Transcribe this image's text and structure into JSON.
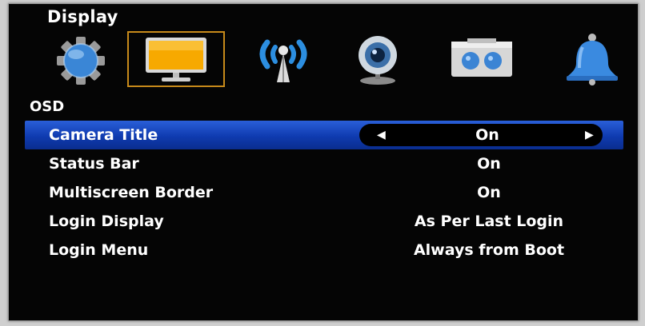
{
  "header": {
    "title": "Display"
  },
  "icons": [
    {
      "name": "gear-icon",
      "selected": false
    },
    {
      "name": "monitor-icon",
      "selected": true
    },
    {
      "name": "network-antenna-icon",
      "selected": false
    },
    {
      "name": "webcam-icon",
      "selected": false
    },
    {
      "name": "hdd-recorder-icon",
      "selected": false
    },
    {
      "name": "bell-icon",
      "selected": false
    }
  ],
  "section": {
    "label": "OSD"
  },
  "settings": [
    {
      "label": "Camera Title",
      "value": "On",
      "active": true
    },
    {
      "label": "Status Bar",
      "value": "On"
    },
    {
      "label": "Multiscreen Border",
      "value": "On"
    },
    {
      "label": "Login Display",
      "value": "As Per Last Login"
    },
    {
      "label": "Login Menu",
      "value": "Always from Boot"
    }
  ],
  "arrows": {
    "left": "◀",
    "right": "▶"
  },
  "colors": {
    "highlight": "#1e4fd0",
    "selected_border": "#c78a1a",
    "background": "#050505"
  }
}
